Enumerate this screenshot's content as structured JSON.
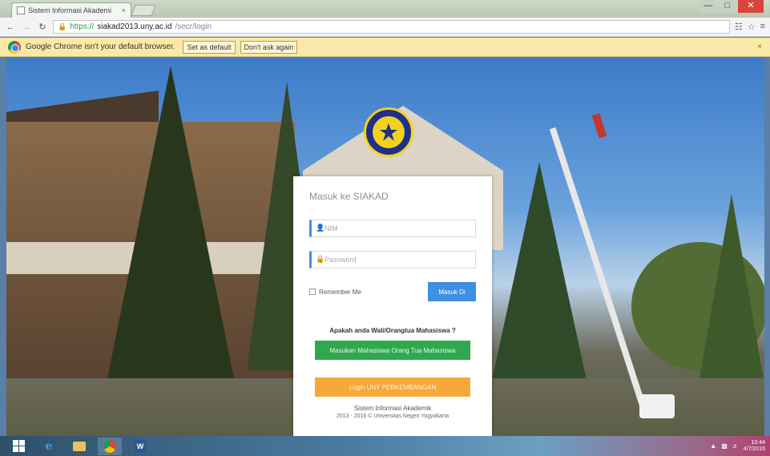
{
  "browser": {
    "tab_title": "Sistem Informasi Akademi",
    "tab_close": "×",
    "window_controls": {
      "minimize": "—",
      "maximize": "□",
      "close": "✕"
    },
    "url_scheme": "https://",
    "url_host": "siakad2013.uny.ac.id",
    "url_path": "/secr/login",
    "lock_icon": "lock-icon"
  },
  "infobar": {
    "message": "Google Chrome isn't your default browser.",
    "set_default_label": "Set as default",
    "dont_ask_label": "Don't ask again",
    "close": "×"
  },
  "login": {
    "title": "Masuk ke SIAKAD",
    "nim_placeholder": "NIM",
    "password_placeholder": "Password",
    "remember_label": "Remember Me",
    "login_button": "Masuk Di",
    "question": "Apakah anda Wali/Orangtua Mahasiswa ?",
    "parent_button": "Masukan Mahasiswa Orang Tua Mahasiswa",
    "orange_button": "Login UNY PERKEMBANGAN",
    "footer_line1": "Sistem Informasi Akademik",
    "footer_line2": "2013 - 2016 © Universitas Negeri Yogyakarta"
  },
  "taskbar": {
    "items": [
      "start-button",
      "ie-icon",
      "file-explorer-icon",
      "chrome-icon",
      "word-icon"
    ],
    "tray_time": "10:44",
    "tray_date": "4/7/2016"
  },
  "colors": {
    "login_button": "#3f8fe3",
    "parent_button": "#2fa84f",
    "orange_button": "#f5a93a",
    "infobar_bg": "#fbe9a7",
    "logo_blue": "#1f2f8c",
    "logo_yellow": "#f2d21f"
  }
}
